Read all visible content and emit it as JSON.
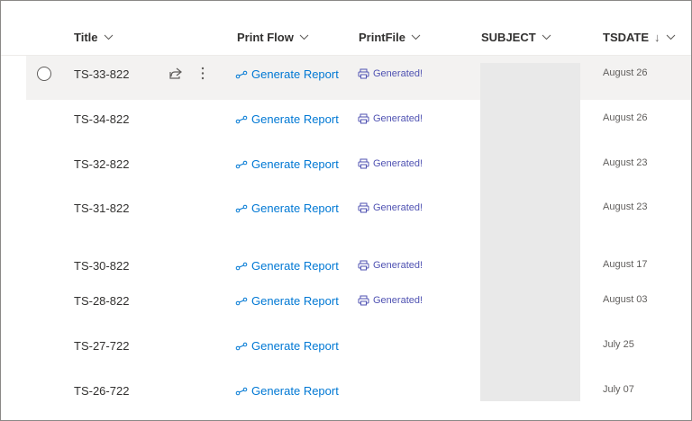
{
  "columns": {
    "title": "Title",
    "print_flow": "Print Flow",
    "print_file": "PrintFile",
    "subject": "SUBJECT",
    "tsdate": "TSDATE",
    "sort_arrow": "↓"
  },
  "rows": [
    {
      "title": "TS-33-822",
      "flow": "Generate Report",
      "file": "Generated!",
      "date": "August 26"
    },
    {
      "title": "TS-34-822",
      "flow": "Generate Report",
      "file": "Generated!",
      "date": "August 26"
    },
    {
      "title": "TS-32-822",
      "flow": "Generate Report",
      "file": "Generated!",
      "date": "August 23"
    },
    {
      "title": "TS-31-822",
      "flow": "Generate Report",
      "file": "Generated!",
      "date": "August 23"
    },
    {
      "title": "TS-30-822",
      "flow": "Generate Report",
      "file": "Generated!",
      "date": "August 17"
    },
    {
      "title": "TS-28-822",
      "flow": "Generate Report",
      "file": "Generated!",
      "date": "August 03"
    },
    {
      "title": "TS-27-722",
      "flow": "Generate Report",
      "file": "",
      "date": "July 25"
    },
    {
      "title": "TS-26-722",
      "flow": "Generate Report",
      "file": "",
      "date": "July 07"
    }
  ],
  "icons": {
    "chevron": "chevron-down-icon",
    "share": "share-icon",
    "more": "more-vertical-icon",
    "flow": "flow-icon",
    "print": "printer-icon",
    "radio": "row-select-radio"
  },
  "colors": {
    "link": "#0078d4",
    "generated": "#4f52b2",
    "selected_row": "#f3f2f1",
    "redaction": "#e9e9e9"
  }
}
